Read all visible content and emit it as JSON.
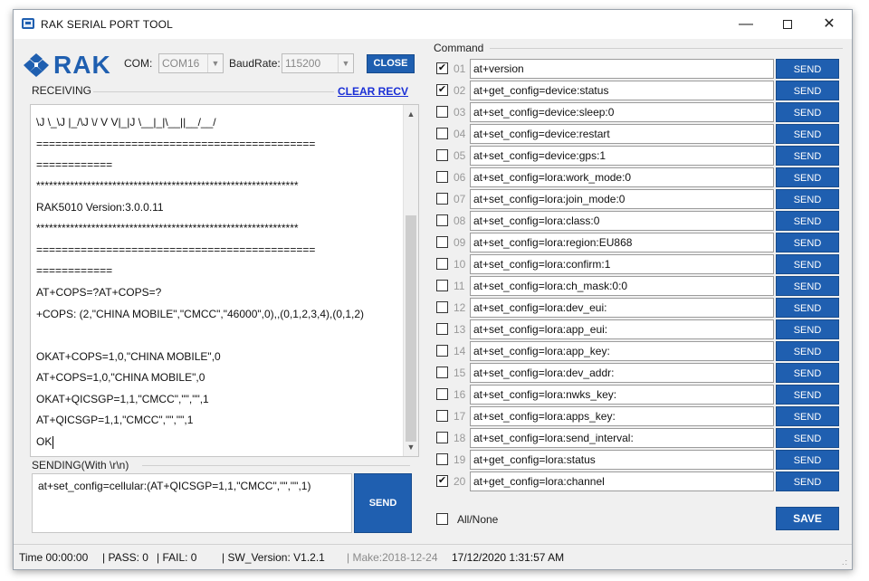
{
  "window": {
    "title": "RAK SERIAL PORT TOOL"
  },
  "logo": {
    "text": "RAK"
  },
  "serial": {
    "com_label": "COM:",
    "com_value": "COM16",
    "baud_label": "BaudRate:",
    "baud_value": "115200",
    "close_label": "CLOSE"
  },
  "receiving": {
    "label": "RECEIVING",
    "clear_label": "CLEAR RECV",
    "lines": [
      "\\J \\_\\J |_/\\J \\/  V  V|_|J  \\__|_|\\__||__/__/",
      "============================================",
      "============",
      "**************************************************************",
      "RAK5010 Version:3.0.0.11",
      "**************************************************************",
      "============================================",
      "============",
      "AT+COPS=?AT+COPS=?",
      "+COPS: (2,\"CHINA MOBILE\",\"CMCC\",\"46000\",0),,(0,1,2,3,4),(0,1,2)",
      "",
      "OKAT+COPS=1,0,\"CHINA MOBILE\",0",
      "AT+COPS=1,0,\"CHINA MOBILE\",0",
      "OKAT+QICSGP=1,1,\"CMCC\",\"\",\"\",1",
      "AT+QICSGP=1,1,\"CMCC\",\"\",\"\",1",
      "OK"
    ]
  },
  "sending": {
    "label": "SENDING(With \\r\\n)",
    "value": "at+set_config=cellular:(AT+QICSGP=1,1,\"CMCC\",\"\",\"\",1)",
    "send_label": "SEND"
  },
  "command": {
    "label": "Command",
    "send_label": "SEND",
    "rows": [
      {
        "num": "01",
        "checked": true,
        "cmd": "at+version"
      },
      {
        "num": "02",
        "checked": true,
        "cmd": "at+get_config=device:status"
      },
      {
        "num": "03",
        "checked": false,
        "cmd": "at+set_config=device:sleep:0"
      },
      {
        "num": "04",
        "checked": false,
        "cmd": "at+set_config=device:restart"
      },
      {
        "num": "05",
        "checked": false,
        "cmd": "at+set_config=device:gps:1"
      },
      {
        "num": "06",
        "checked": false,
        "cmd": "at+set_config=lora:work_mode:0"
      },
      {
        "num": "07",
        "checked": false,
        "cmd": "at+set_config=lora:join_mode:0"
      },
      {
        "num": "08",
        "checked": false,
        "cmd": "at+set_config=lora:class:0"
      },
      {
        "num": "09",
        "checked": false,
        "cmd": "at+set_config=lora:region:EU868"
      },
      {
        "num": "10",
        "checked": false,
        "cmd": "at+set_config=lora:confirm:1"
      },
      {
        "num": "11",
        "checked": false,
        "cmd": "at+set_config=lora:ch_mask:0:0"
      },
      {
        "num": "12",
        "checked": false,
        "cmd": "at+set_config=lora:dev_eui:"
      },
      {
        "num": "13",
        "checked": false,
        "cmd": "at+set_config=lora:app_eui:"
      },
      {
        "num": "14",
        "checked": false,
        "cmd": "at+set_config=lora:app_key:"
      },
      {
        "num": "15",
        "checked": false,
        "cmd": "at+set_config=lora:dev_addr:"
      },
      {
        "num": "16",
        "checked": false,
        "cmd": "at+set_config=lora:nwks_key:"
      },
      {
        "num": "17",
        "checked": false,
        "cmd": "at+set_config=lora:apps_key:"
      },
      {
        "num": "18",
        "checked": false,
        "cmd": "at+set_config=lora:send_interval:"
      },
      {
        "num": "19",
        "checked": false,
        "cmd": "at+get_config=lora:status"
      },
      {
        "num": "20",
        "checked": true,
        "cmd": "at+get_config=lora:channel"
      }
    ],
    "all_none_label": "All/None",
    "save_label": "SAVE"
  },
  "status": {
    "time": "Time  00:00:00",
    "pass": "| PASS:  0",
    "fail": "| FAIL:  0",
    "sw": "| SW_Version:  V1.2.1",
    "make": "| Make:2018-12-24",
    "datetime": "17/12/2020 1:31:57 AM"
  },
  "colors": {
    "accent": "#1f5fb0",
    "link": "#1a2fd6"
  }
}
